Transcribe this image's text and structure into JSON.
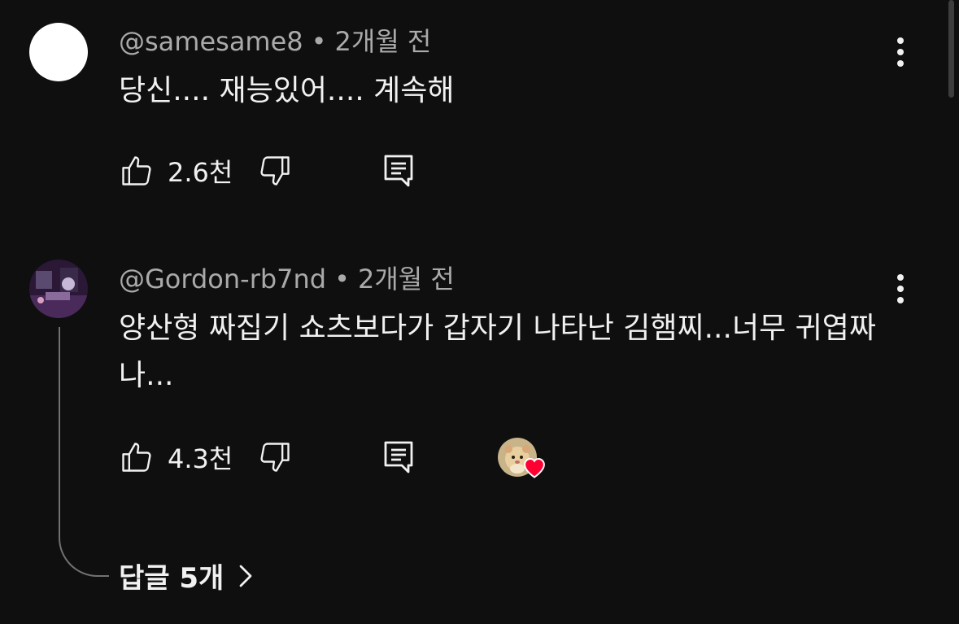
{
  "comments": [
    {
      "author": "@samesame8",
      "time": "2개월 전",
      "text": "당신.... 재능있어.... 계속해",
      "likes": "2.6천",
      "avatar_color": "#ffffff"
    },
    {
      "author": "@Gordon-rb7nd",
      "time": "2개월 전",
      "text": "양산형 짜집기 쇼츠보다가 갑자기 나타난 김햄찌...너무 귀엽짜나...",
      "likes": "4.3천",
      "creator_heart": true,
      "replies_label": "답글 5개"
    }
  ],
  "separator": "•",
  "icons": {
    "like": "thumbs-up-icon",
    "dislike": "thumbs-down-icon",
    "reply": "reply-comment-icon",
    "menu": "more-vertical-icon",
    "heart": "heart-icon",
    "chevron": "chevron-right-icon"
  },
  "colors": {
    "background": "#0f0f0f",
    "text_primary": "#f1f1f1",
    "text_secondary": "#aaaaaa",
    "heart": "#ff0033",
    "thread_line": "#717171"
  }
}
